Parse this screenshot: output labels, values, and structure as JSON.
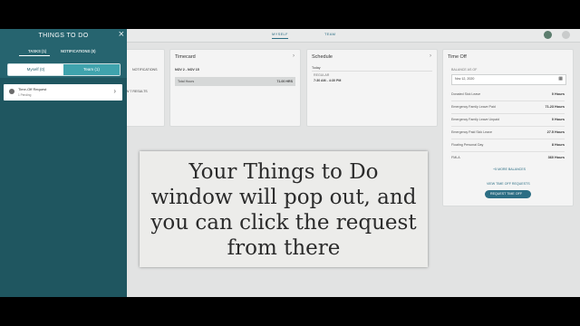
{
  "topnav": {
    "tab_myself": "MYSELF",
    "tab_team": "TEAM"
  },
  "panel": {
    "title": "THINGS TO DO",
    "tab_tasks": "TASKS (1)",
    "tab_notifications": "NOTIFICATIONS (0)",
    "seg_myself": "Myself (0)",
    "seg_team": "Team (1)",
    "request_title": "Time-Off Request",
    "request_status": "1 Pending"
  },
  "behind": {
    "notifications": "NOTIFICATIONS",
    "partial": "W 7 RESULTS"
  },
  "timecard": {
    "title": "Timecard",
    "range": "NOV 2 - NOV 15",
    "total_label": "Total Hours",
    "total_value": "71.00 HRS"
  },
  "schedule": {
    "title": "Schedule",
    "today": "Today",
    "shift": "REGULAR",
    "time": "7:30 AM - 4:30 PM"
  },
  "timeoff": {
    "title": "Time Off",
    "balance_label": "BALANCE AS OF",
    "date": "Nov 12, 2020",
    "rows": [
      {
        "name": "Donated Sick Leave",
        "value": "0 Hours"
      },
      {
        "name": "Emergency Family Leave Paid",
        "value": "71.23 Hours"
      },
      {
        "name": "Emergency Family Leave Unpaid",
        "value": "0 Hours"
      },
      {
        "name": "Emergency Paid Sick Leave",
        "value": "27.5 Hours"
      },
      {
        "name": "Floating Personal Day",
        "value": "8 Hours"
      },
      {
        "name": "FMLA",
        "value": "360 Hours"
      }
    ],
    "more": "+5 MORE BALANCES",
    "view_link": "VIEW TIME OFF REQUESTS",
    "request_btn": "REQUEST TIME OFF"
  },
  "caption": {
    "line1": "Your Things to Do",
    "line2": "window will pop out, and",
    "line3": "you can click the request",
    "line4": "from there"
  }
}
